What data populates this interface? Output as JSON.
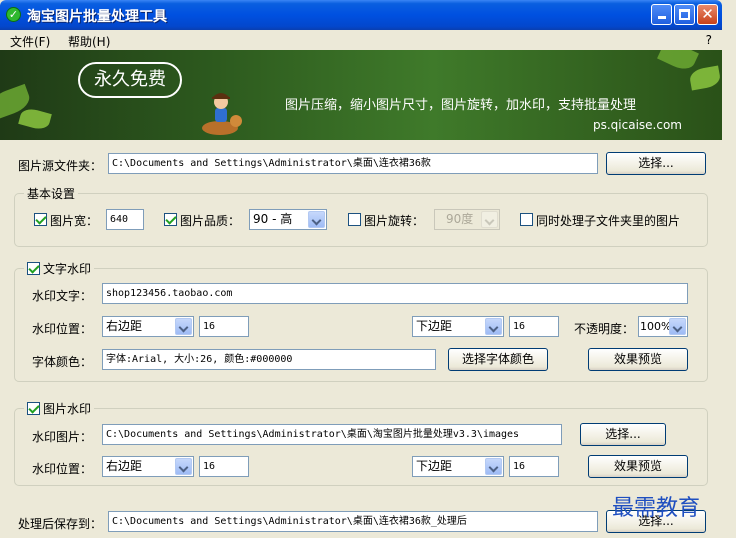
{
  "window": {
    "title": "淘宝图片批量处理工具"
  },
  "menu": {
    "items": [
      {
        "label": "文件(F)"
      },
      {
        "label": "帮助(H)"
      }
    ],
    "help_glyph": "?"
  },
  "banner": {
    "badge": "永久免费",
    "tagline": "图片压缩，缩小图片尺寸，图片旋转，加水印，支持批量处理",
    "url": "ps.qicaise.com"
  },
  "source": {
    "label": "图片源文件夹：",
    "value": "C:\\Documents and Settings\\Administrator\\桌面\\连衣裙36款",
    "button": "选择..."
  },
  "basic": {
    "title": "基本设置",
    "width_label": "图片宽：",
    "width_checked": true,
    "width_value": "640",
    "quality_label": "图片品质：",
    "quality_checked": true,
    "quality_value": "90 - 高",
    "rotate_label": "图片旋转：",
    "rotate_checked": false,
    "rotate_value": "90度",
    "subfolder_label": "同时处理子文件夹里的图片",
    "subfolder_checked": false
  },
  "text_wm": {
    "title": "文字水印",
    "checked": true,
    "text_label": "水印文字：",
    "text_value": "shop123456.taobao.com",
    "pos_label": "水印位置：",
    "h_pos": "右边距",
    "h_val": "16",
    "v_pos": "下边距",
    "v_val": "16",
    "opacity_label": "不透明度：",
    "opacity_value": "100%",
    "color_label": "字体颜色：",
    "color_value": "字体:Arial, 大小:26, 颜色:#000000",
    "choose_color_btn": "选择字体颜色",
    "preview_btn": "效果预览"
  },
  "image_wm": {
    "title": "图片水印",
    "checked": true,
    "image_label": "水印图片：",
    "image_value": "C:\\Documents and Settings\\Administrator\\桌面\\淘宝图片批量处理v3.3\\images",
    "choose_btn": "选择...",
    "pos_label": "水印位置：",
    "h_pos": "右边距",
    "h_val": "16",
    "v_pos": "下边距",
    "v_val": "16",
    "preview_btn": "效果预览"
  },
  "output": {
    "label": "处理后保存到：",
    "value": "C:\\Documents and Settings\\Administrator\\桌面\\连衣裙36款_处理后",
    "button": "选择..."
  },
  "overlay_watermark": "最需教育"
}
